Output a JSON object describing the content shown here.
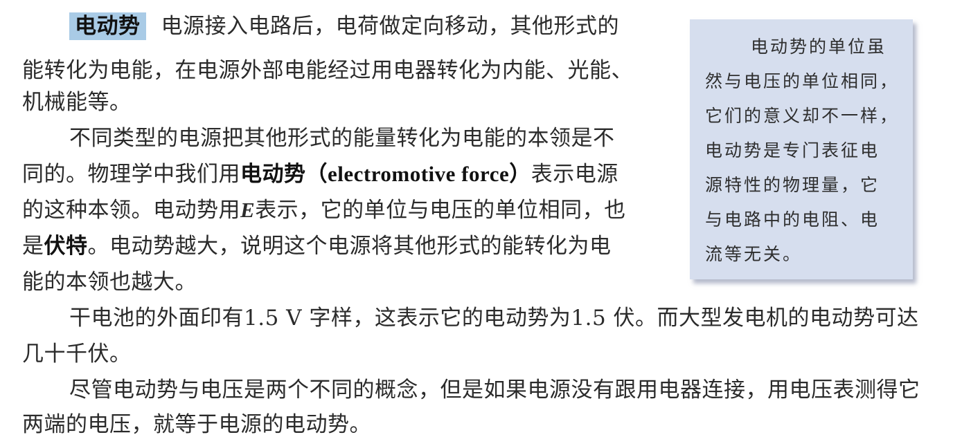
{
  "main": {
    "p1_term": "电动势",
    "p1_l1": "电源接入电路后，电荷做定向移动，其他形式的",
    "p1_l2": "能转化为电能，在电源外部电能经过用电器转化为内能、光能、",
    "p1_l3": "机械能等。",
    "p2_l1": "不同类型的电源把其他形式的能量转化为电能的本领是不",
    "p2_l2_a": "同的。物理学中我们用",
    "p2_l2_term": "电动势",
    "p2_l2_en": "（electromotive force）",
    "p2_l2_b": "表示电源",
    "p2_l3_a": "的这种本领。电动势用",
    "p2_l3_sym": "E",
    "p2_l3_b": "表示，它的单位与电压的单位相同，也",
    "p2_l4_a": "是",
    "p2_l4_unit": "伏特",
    "p2_l4_b": "。电动势越大，说明这个电源将其他形式的能转化为电",
    "p2_l5": "能的本领也越大。",
    "p3_l1": "干电池的外面印有1.5 V 字样，这表示它的电动势为1.5 伏。而大型发电机的电动势可达",
    "p3_l2": "几十千伏。",
    "p4_l1": "尽管电动势与电压是两个不同的概念，但是如果电源没有跟用电器连接，用电压表测得它",
    "p4_l2": "两端的电压，就等于电源的电动势。"
  },
  "sidenote": {
    "lines": [
      "电动势的单位虽",
      "然与电压的单位相同，",
      "它们的意义却不一样，",
      "电动势是专门表征电",
      "源特性的物理量，它",
      "与电路中的电阻、电",
      "流等无关。"
    ]
  }
}
